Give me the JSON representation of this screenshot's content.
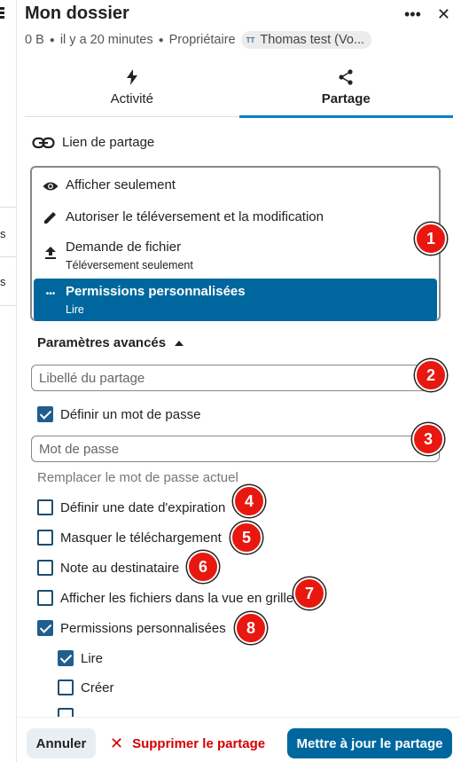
{
  "left": {
    "frag1": "s",
    "frag2": "s"
  },
  "header": {
    "title": "Mon dossier",
    "more_icon": "more-horizontal-icon",
    "close_icon": "close-icon",
    "size": "0 B",
    "modified": "il y a 20 minutes",
    "owner_label": "Propriétaire",
    "owner_initials": "TT",
    "owner_name": "Thomas test (Vo..."
  },
  "tabs": [
    {
      "label": "Activité",
      "icon": "lightning-icon"
    },
    {
      "label": "Partage",
      "icon": "share-icon",
      "active": true
    }
  ],
  "share_link": {
    "label": "Lien de partage",
    "icon": "link-icon"
  },
  "permissions": {
    "options": [
      {
        "label": "Afficher seulement",
        "icon": "eye-icon"
      },
      {
        "label": "Autoriser le téléversement et la modification",
        "icon": "pencil-icon"
      },
      {
        "label": "Demande de fichier",
        "sub": "Téléversement seulement",
        "icon": "upload-icon"
      },
      {
        "label": "Permissions personnalisées",
        "sub": "Lire",
        "icon": "more-horizontal-icon",
        "selected": true
      }
    ]
  },
  "advanced": {
    "title": "Paramètres avancés",
    "label_placeholder": "Libellé du partage",
    "set_password": "Définir un mot de passe",
    "password_placeholder": "Mot de passe",
    "replace_password": "Remplacer le mot de passe actuel",
    "expiration": "Définir une date d'expiration",
    "hide_download": "Masquer le téléchargement",
    "note": "Note au destinataire",
    "grid_view": "Afficher les fichiers dans la vue en grille",
    "custom_permissions": "Permissions personnalisées",
    "read": "Lire",
    "create": "Créer"
  },
  "badges": [
    "1",
    "2",
    "3",
    "4",
    "5",
    "6",
    "7",
    "8"
  ],
  "footer": {
    "cancel": "Annuler",
    "delete": "Supprimer le partage",
    "update": "Mettre à jour le partage"
  },
  "colors": {
    "primary": "#00679e",
    "accent_line": "#0082c9",
    "danger": "#d40000",
    "badge": "#e8170f"
  }
}
